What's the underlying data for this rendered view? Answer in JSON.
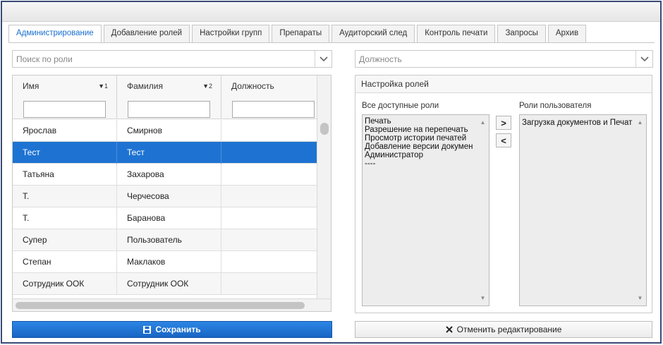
{
  "tabs": [
    {
      "label": "Администрирование",
      "active": true
    },
    {
      "label": "Добавление ролей",
      "active": false
    },
    {
      "label": "Настройки групп",
      "active": false
    },
    {
      "label": "Препараты",
      "active": false
    },
    {
      "label": "Аудиторский след",
      "active": false
    },
    {
      "label": "Контроль печати",
      "active": false
    },
    {
      "label": "Запросы",
      "active": false
    },
    {
      "label": "Архив",
      "active": false
    }
  ],
  "role_search": {
    "placeholder": "Поиск по роли"
  },
  "position_select": {
    "placeholder": "Должность"
  },
  "grid": {
    "columns": [
      {
        "label": "Имя",
        "sort": "▼1"
      },
      {
        "label": "Фамилия",
        "sort": "▼2"
      },
      {
        "label": "Должность",
        "sort": ""
      }
    ],
    "rows": [
      {
        "first": "Ярослав",
        "last": "Смирнов",
        "position": "",
        "selected": false
      },
      {
        "first": "Тест",
        "last": "Тест",
        "position": "",
        "selected": true
      },
      {
        "first": "Татьяна",
        "last": "Захарова",
        "position": "",
        "selected": false
      },
      {
        "first": "Т.",
        "last": "Черчесова",
        "position": "",
        "selected": false
      },
      {
        "first": "Т.",
        "last": "Баранова",
        "position": "",
        "selected": false
      },
      {
        "first": "Супер",
        "last": "Пользователь",
        "position": "",
        "selected": false
      },
      {
        "first": "Степан",
        "last": "Маклаков",
        "position": "",
        "selected": false
      },
      {
        "first": "Сотрудник ООК",
        "last": "Сотрудник ООК",
        "position": "",
        "selected": false
      }
    ]
  },
  "roles_panel": {
    "title": "Настройка ролей",
    "available_label": "Все доступные роли",
    "user_label": "Роли пользователя",
    "available_roles": [
      "Печать",
      "Разрешение на перепечать",
      "Просмотр истории печатей",
      "Добавление версии докумен",
      "Администратор",
      "----"
    ],
    "user_roles": [
      "Загрузка документов и Печат"
    ],
    "move_right_label": ">",
    "move_left_label": "<"
  },
  "buttons": {
    "save": "Сохранить",
    "cancel": "Отменить редактирование"
  },
  "colors": {
    "accent": "#1e73d2",
    "active_tab_text": "#1a6fcf"
  }
}
